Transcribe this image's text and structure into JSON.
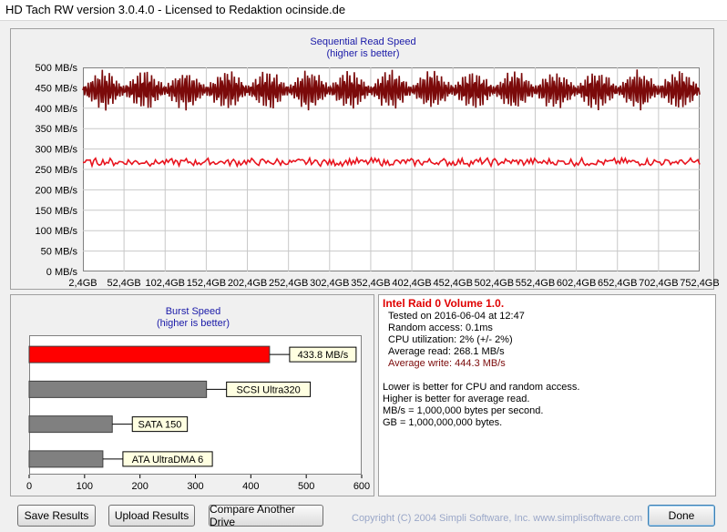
{
  "window": {
    "title": "HD Tach RW version 3.0.4.0 - Licensed to Redaktion ocinside.de"
  },
  "sequential": {
    "title": "Sequential Read Speed",
    "subtitle": "(higher is better)"
  },
  "burst": {
    "title": "Burst Speed",
    "subtitle": "(higher is better)"
  },
  "info": {
    "drive_name": "Intel Raid 0 Volume 1.0.",
    "tested_on": "Tested on 2016-06-04 at 12:47",
    "random_access": "Random access: 0.1ms",
    "cpu_utilization": "CPU utilization: 2% (+/- 2%)",
    "average_read": "Average read: 268.1 MB/s",
    "average_write": "Average write: 444.3 MB/s",
    "note1": "Lower is better for CPU and random access.",
    "note2": "Higher is better for average read.",
    "note3": "MB/s = 1,000,000 bytes per second.",
    "note4": "GB = 1,000,000,000 bytes."
  },
  "buttons": {
    "save": "Save Results",
    "upload": "Upload Results",
    "compare": "Compare Another Drive",
    "done": "Done"
  },
  "copyright": "Copyright (C) 2004 Simpli Software, Inc. www.simplisoftware.com",
  "colors": {
    "write_line": "#7b0a0a",
    "read_line": "#e8141e",
    "bar_highlight": "#ff0000",
    "bar_other": "#808080",
    "title_blue": "#1a1aa8",
    "drive_name_red": "#e00000"
  },
  "chart_data": [
    {
      "type": "line",
      "title": "Sequential Read Speed",
      "subtitle": "(higher is better)",
      "ylim": [
        0,
        500
      ],
      "yticks": [
        "0 MB/s",
        "50 MB/s",
        "100 MB/s",
        "150 MB/s",
        "200 MB/s",
        "250 MB/s",
        "300 MB/s",
        "350 MB/s",
        "400 MB/s",
        "450 MB/s",
        "500 MB/s"
      ],
      "xticks": [
        "2,4GB",
        "52,4GB",
        "102,4GB",
        "152,4GB",
        "202,4GB",
        "252,4GB",
        "302,4GB",
        "352,4GB",
        "402,4GB",
        "452,4GB",
        "502,4GB",
        "552,4GB",
        "602,4GB",
        "652,4GB",
        "702,4GB",
        "752,4GB"
      ],
      "xlim": [
        2.4,
        752.4
      ],
      "grid": true,
      "series": [
        {
          "color": "#7b0a0a",
          "mean": 444,
          "amplitude": 45,
          "burst_period_gb": 50
        },
        {
          "color": "#e8141e",
          "mean": 268,
          "amplitude": 10
        }
      ]
    },
    {
      "type": "bar",
      "title": "Burst Speed",
      "subtitle": "(higher is better)",
      "orientation": "horizontal",
      "xlim": [
        0,
        600
      ],
      "xticks": [
        "0",
        "100",
        "200",
        "300",
        "400",
        "500",
        "600"
      ],
      "categories": [
        "433.8 MB/s",
        "SCSI Ultra320",
        "SATA 150",
        "ATA UltraDMA 6"
      ],
      "values": [
        433.8,
        320,
        150,
        133
      ],
      "bar_colors": [
        "#ff0000",
        "#808080",
        "#808080",
        "#808080"
      ]
    }
  ]
}
